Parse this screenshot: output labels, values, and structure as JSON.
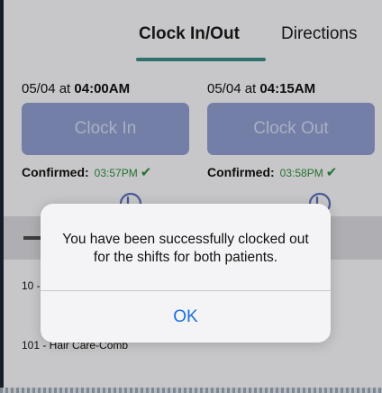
{
  "tabs": [
    {
      "label": "Clock In/Out",
      "active": true
    },
    {
      "label": "Directions",
      "active": false
    }
  ],
  "shifts": [
    {
      "date": "05/04 at ",
      "time": "04:00AM",
      "button_label": "Clock In",
      "confirmed_label": "Confirmed:",
      "confirmed_time": "03:57PM"
    },
    {
      "date": "05/04 at ",
      "time": "04:15AM",
      "button_label": "Clock Out",
      "confirmed_label": "Confirmed:",
      "confirmed_time": "03:58PM"
    }
  ],
  "tasks": [
    {
      "label": "10 -"
    },
    {
      "label": "101 - Hair Care-Comb"
    }
  ],
  "alert": {
    "message": "You have been successfully clocked out for the shifts for both patients.",
    "ok_label": "OK"
  },
  "colors": {
    "accent": "#3b8a86",
    "button_bg": "#8e9bcc",
    "confirmed_green": "#2e8b3c",
    "ok_blue": "#1a6fe0"
  },
  "icons": {
    "check": "check-icon",
    "history": "clock-history-icon"
  }
}
